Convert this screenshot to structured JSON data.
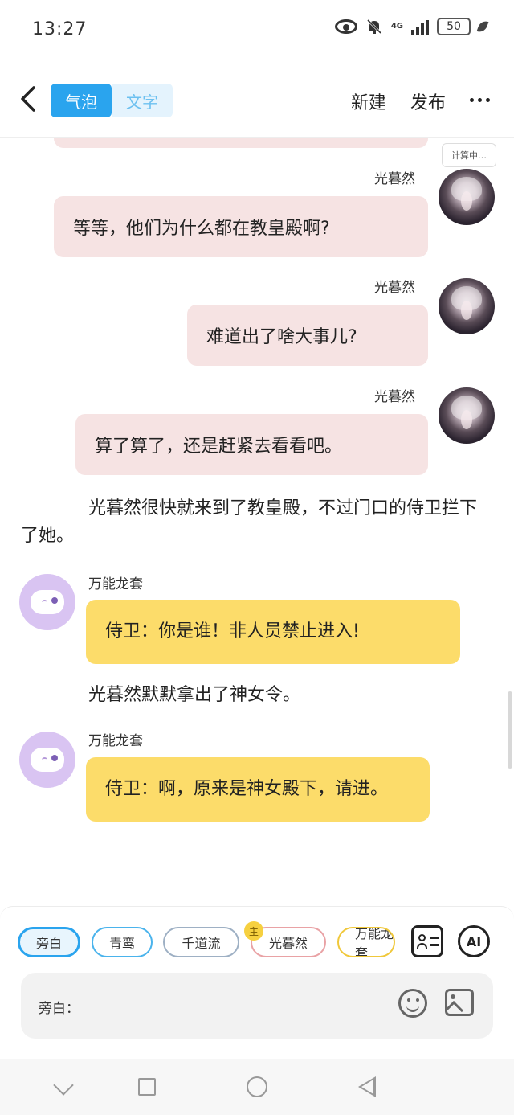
{
  "status_bar": {
    "time": "13:27",
    "network": "4G",
    "battery": "50"
  },
  "nav": {
    "segments": [
      "气泡",
      "文字"
    ],
    "actions": [
      "新建",
      "发布"
    ]
  },
  "chat": {
    "calc_tag": "计算中…",
    "messages": [
      {
        "speaker": "光暮然",
        "text": "等等，他们为什么都在教皇殿啊?"
      },
      {
        "speaker": "光暮然",
        "text": "难道出了啥大事儿?"
      },
      {
        "speaker": "光暮然",
        "text": "算了算了，还是赶紧去看看吧。"
      }
    ],
    "narration_1": "光暮然很快就来到了教皇殿，不过门口的侍卫拦下了她。",
    "bot_1": {
      "speaker": "万能龙套",
      "text": "侍卫：你是谁！非人员禁止进入!"
    },
    "narration_2": "光暮然默默拿出了神女令。",
    "bot_2": {
      "speaker": "万能龙套",
      "text": "侍卫：啊，原来是神女殿下，请进。"
    }
  },
  "panel": {
    "roles": [
      "旁白",
      "青鸾",
      "千道流",
      "光暮然",
      "万能龙套"
    ],
    "main_badge": "主",
    "ai_label": "AI",
    "input_label": "旁白："
  },
  "colors": {
    "accent": "#2aa4ee",
    "pink_bubble": "#f6e3e3",
    "yellow_bubble": "#fcdc6a",
    "bot_avatar": "#d9c4f2"
  }
}
